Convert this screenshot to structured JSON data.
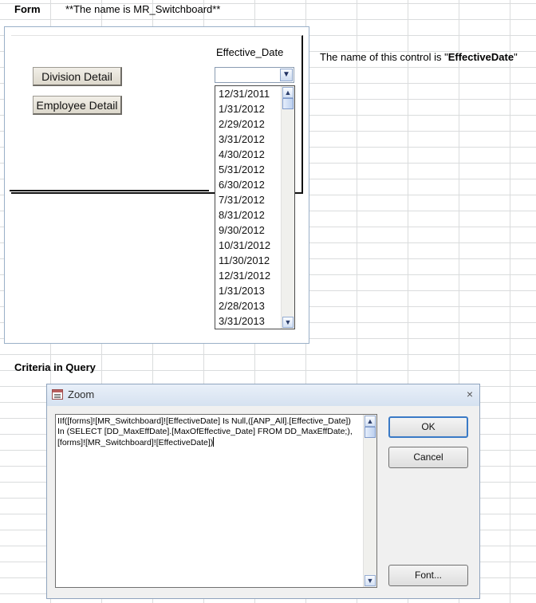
{
  "sheet": {
    "form_label": "Form",
    "form_name_note": "**The name is MR_Switchboard**",
    "control_note_prefix": "The name of this control is \"",
    "control_note_name": "EffectiveDate",
    "control_note_suffix": "\"",
    "criteria_label": "Criteria in Query"
  },
  "form": {
    "buttons": {
      "division_detail": "Division Detail",
      "employee_detail": "Employee Detail"
    },
    "effective_date_label": "Effective_Date",
    "combo": {
      "value": "",
      "dropdown_icon": "chevron-down-icon"
    },
    "date_options": [
      "12/31/2011",
      "1/31/2012",
      "2/29/2012",
      "3/31/2012",
      "4/30/2012",
      "5/31/2012",
      "6/30/2012",
      "7/31/2012",
      "8/31/2012",
      "9/30/2012",
      "10/31/2012",
      "11/30/2012",
      "12/31/2012",
      "1/31/2013",
      "2/28/2013",
      "3/31/2013"
    ]
  },
  "zoom_dialog": {
    "title": "Zoom",
    "close_symbol": "×",
    "expression": "IIf([forms]![MR_Switchboard]![EffectiveDate] Is Null,([ANP_All].[Effective_Date]) In (SELECT [DD_MaxEffDate].[MaxOfEffective_Date] FROM DD_MaxEffDate;),[forms]![MR_Switchboard]![EffectiveDate])",
    "ok_label": "OK",
    "cancel_label": "Cancel",
    "font_label": "Font...",
    "font_label_mnemonic": "F"
  },
  "colors": {
    "grid": "#dadcdd",
    "dialog_title": "#d5e1f0",
    "default_button_border": "#3a7ac6"
  }
}
